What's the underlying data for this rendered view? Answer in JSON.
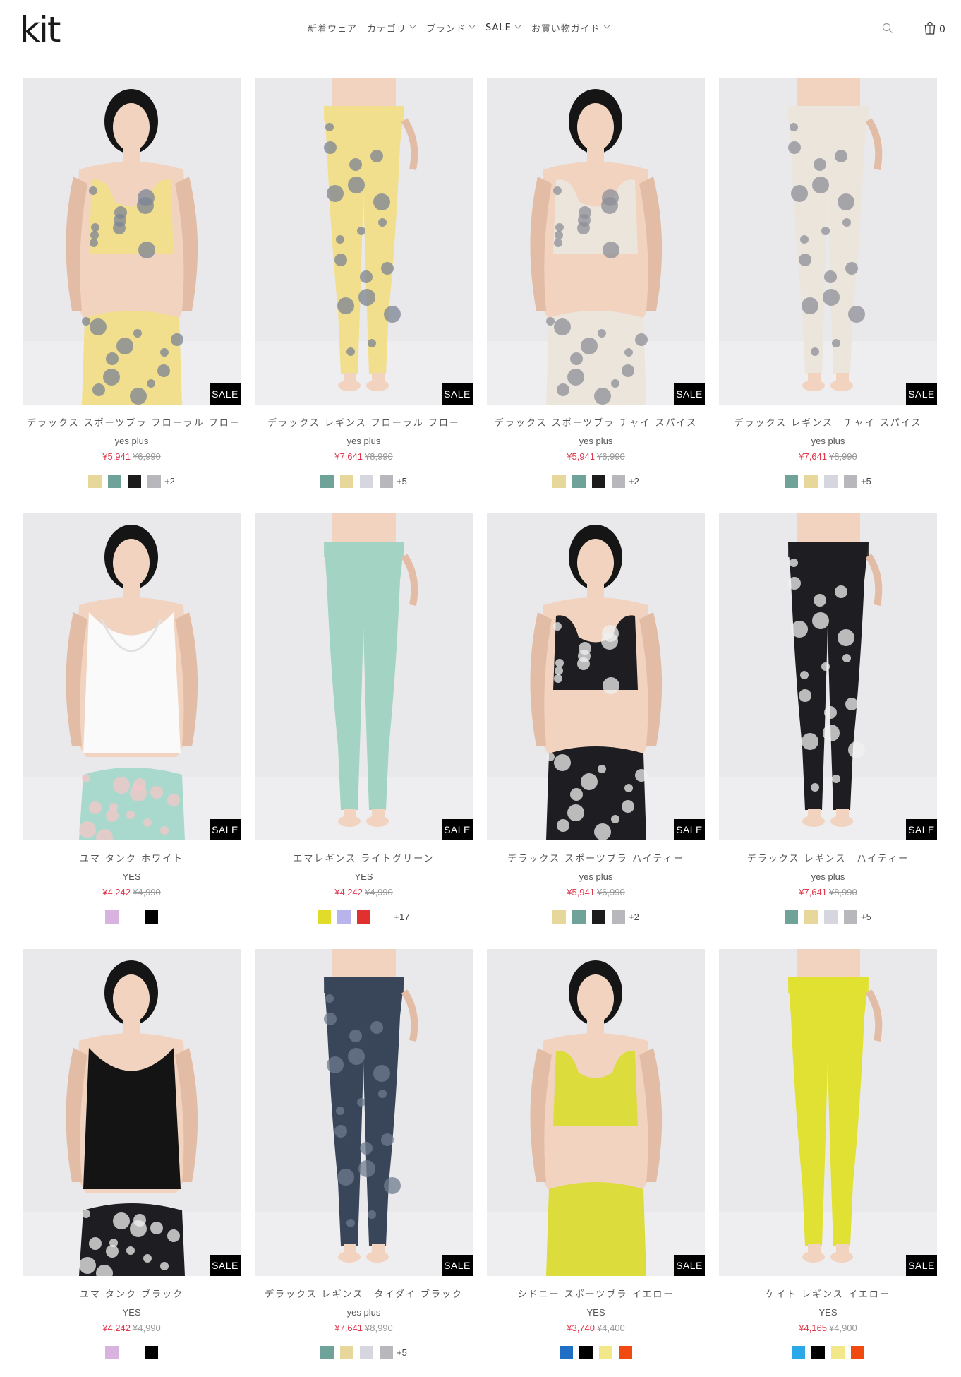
{
  "header": {
    "logo": "kit",
    "nav": [
      {
        "label": "新着ウェア",
        "has_dropdown": false
      },
      {
        "label": "カテゴリ",
        "has_dropdown": true
      },
      {
        "label": "ブランド",
        "has_dropdown": true
      },
      {
        "label": "SALE",
        "has_dropdown": true
      },
      {
        "label": "お買い物ガイド",
        "has_dropdown": true
      }
    ],
    "cart_count": "0"
  },
  "badge_label": "SALE",
  "products": [
    {
      "title": "デラックス スポーツブラ フローラル フロー",
      "brand": "yes plus",
      "price": "¥5,941",
      "was": "¥6,990",
      "kind": "bra",
      "top": "#f2df8e",
      "bottom": "#f2df8e",
      "skin": true,
      "pattern": "#7b8494",
      "swatches": [
        "#e8d79a",
        "#6fa39a",
        "#1c1c1c",
        "#b8b8bc"
      ],
      "more": "+2"
    },
    {
      "title": "デラックス レギンス フローラル フロー",
      "brand": "yes plus",
      "price": "¥7,641",
      "was": "¥8,990",
      "kind": "leggings",
      "top": "#f2df8e",
      "bottom": "#f2df8e",
      "skin": true,
      "pattern": "#7b8494",
      "swatches": [
        "#6fa39a",
        "#e8d79a",
        "#d6d6de",
        "#b8b8bc"
      ],
      "more": "+5"
    },
    {
      "title": "デラックス スポーツブラ チャイ スパイス",
      "brand": "yes plus",
      "price": "¥5,941",
      "was": "¥6,990",
      "kind": "bra",
      "top": "#ebe5dc",
      "bottom": "#ebe5dc",
      "skin": true,
      "pattern": "#8d8f98",
      "swatches": [
        "#e8d79a",
        "#6fa39a",
        "#1c1c1c",
        "#b8b8bc"
      ],
      "more": "+2"
    },
    {
      "title": "デラックス レギンス　チャイ スパイス",
      "brand": "yes plus",
      "price": "¥7,641",
      "was": "¥8,990",
      "kind": "leggings",
      "top": "#ebe5dc",
      "bottom": "#ebe5dc",
      "skin": true,
      "pattern": "#8d8f98",
      "swatches": [
        "#6fa39a",
        "#e8d79a",
        "#d6d6de",
        "#b8b8bc"
      ],
      "more": "+5"
    },
    {
      "title": "ユマ タンク ホワイト",
      "brand": "YES",
      "price": "¥4,242",
      "was": "¥4,990",
      "kind": "tankback",
      "top": "#fafafa",
      "bottom": "#a9d9cc",
      "skin": true,
      "pattern": "#f4c7c9",
      "swatches": [
        "#d9b3e0",
        "transparent",
        "#000000"
      ],
      "more": ""
    },
    {
      "title": "エマレギンス ライトグリーン",
      "brand": "YES",
      "price": "¥4,242",
      "was": "¥4,990",
      "kind": "leggings",
      "top": "#a3d3c3",
      "bottom": "#a3d3c3",
      "skin": true,
      "pattern": "",
      "swatches": [
        "#e1dc2a",
        "#b9b5ec",
        "#e0302f",
        "transparent"
      ],
      "more": "+17"
    },
    {
      "title": "デラックス スポーツブラ ハイティー",
      "brand": "yes plus",
      "price": "¥5,941",
      "was": "¥6,990",
      "kind": "bra",
      "top": "#1e1e22",
      "bottom": "#1e1e22",
      "skin": true,
      "pattern": "#f0f0f0",
      "swatches": [
        "#e8d79a",
        "#6fa39a",
        "#1c1c1c",
        "#b8b8bc"
      ],
      "more": "+2"
    },
    {
      "title": "デラックス レギンス　ハイティー",
      "brand": "yes plus",
      "price": "¥7,641",
      "was": "¥8,990",
      "kind": "leggings",
      "top": "#1e1e22",
      "bottom": "#1e1e22",
      "skin": true,
      "pattern": "#f0f0f0",
      "swatches": [
        "#6fa39a",
        "#e8d79a",
        "#d6d6de",
        "#b8b8bc"
      ],
      "more": "+5"
    },
    {
      "title": "ユマ タンク ブラック",
      "brand": "YES",
      "price": "¥4,242",
      "was": "¥4,990",
      "kind": "tank",
      "top": "#141414",
      "bottom": "#1e1e22",
      "skin": true,
      "pattern": "#f0f0f0",
      "swatches": [
        "#d9b3e0",
        "transparent",
        "#000000"
      ],
      "more": ""
    },
    {
      "title": "デラックス レギンス　タイダイ ブラック",
      "brand": "yes plus",
      "price": "¥7,641",
      "was": "¥8,990",
      "kind": "leggings",
      "top": "#39465a",
      "bottom": "#39465a",
      "skin": true,
      "pattern": "#6d7b8e",
      "swatches": [
        "#6fa39a",
        "#e8d79a",
        "#d6d6de",
        "#b8b8bc"
      ],
      "more": "+5"
    },
    {
      "title": "シドニー スポーツブラ イエロー",
      "brand": "YES",
      "price": "¥3,740",
      "was": "¥4,400",
      "kind": "bra",
      "top": "#dcdc3c",
      "bottom": "#dcdc3c",
      "skin": true,
      "pattern": "",
      "swatches": [
        "#1f6fc5",
        "#000000",
        "#f2e88a",
        "#f04a10"
      ],
      "more": ""
    },
    {
      "title": "ケイト レギンス イエロー",
      "brand": "YES",
      "price": "¥4,165",
      "was": "¥4,900",
      "kind": "leggings",
      "top": "#e1e133",
      "bottom": "#e1e133",
      "skin": true,
      "pattern": "",
      "swatches": [
        "#2aa8e8",
        "#000000",
        "#f2e88a",
        "#f04a10"
      ],
      "more": ""
    }
  ]
}
